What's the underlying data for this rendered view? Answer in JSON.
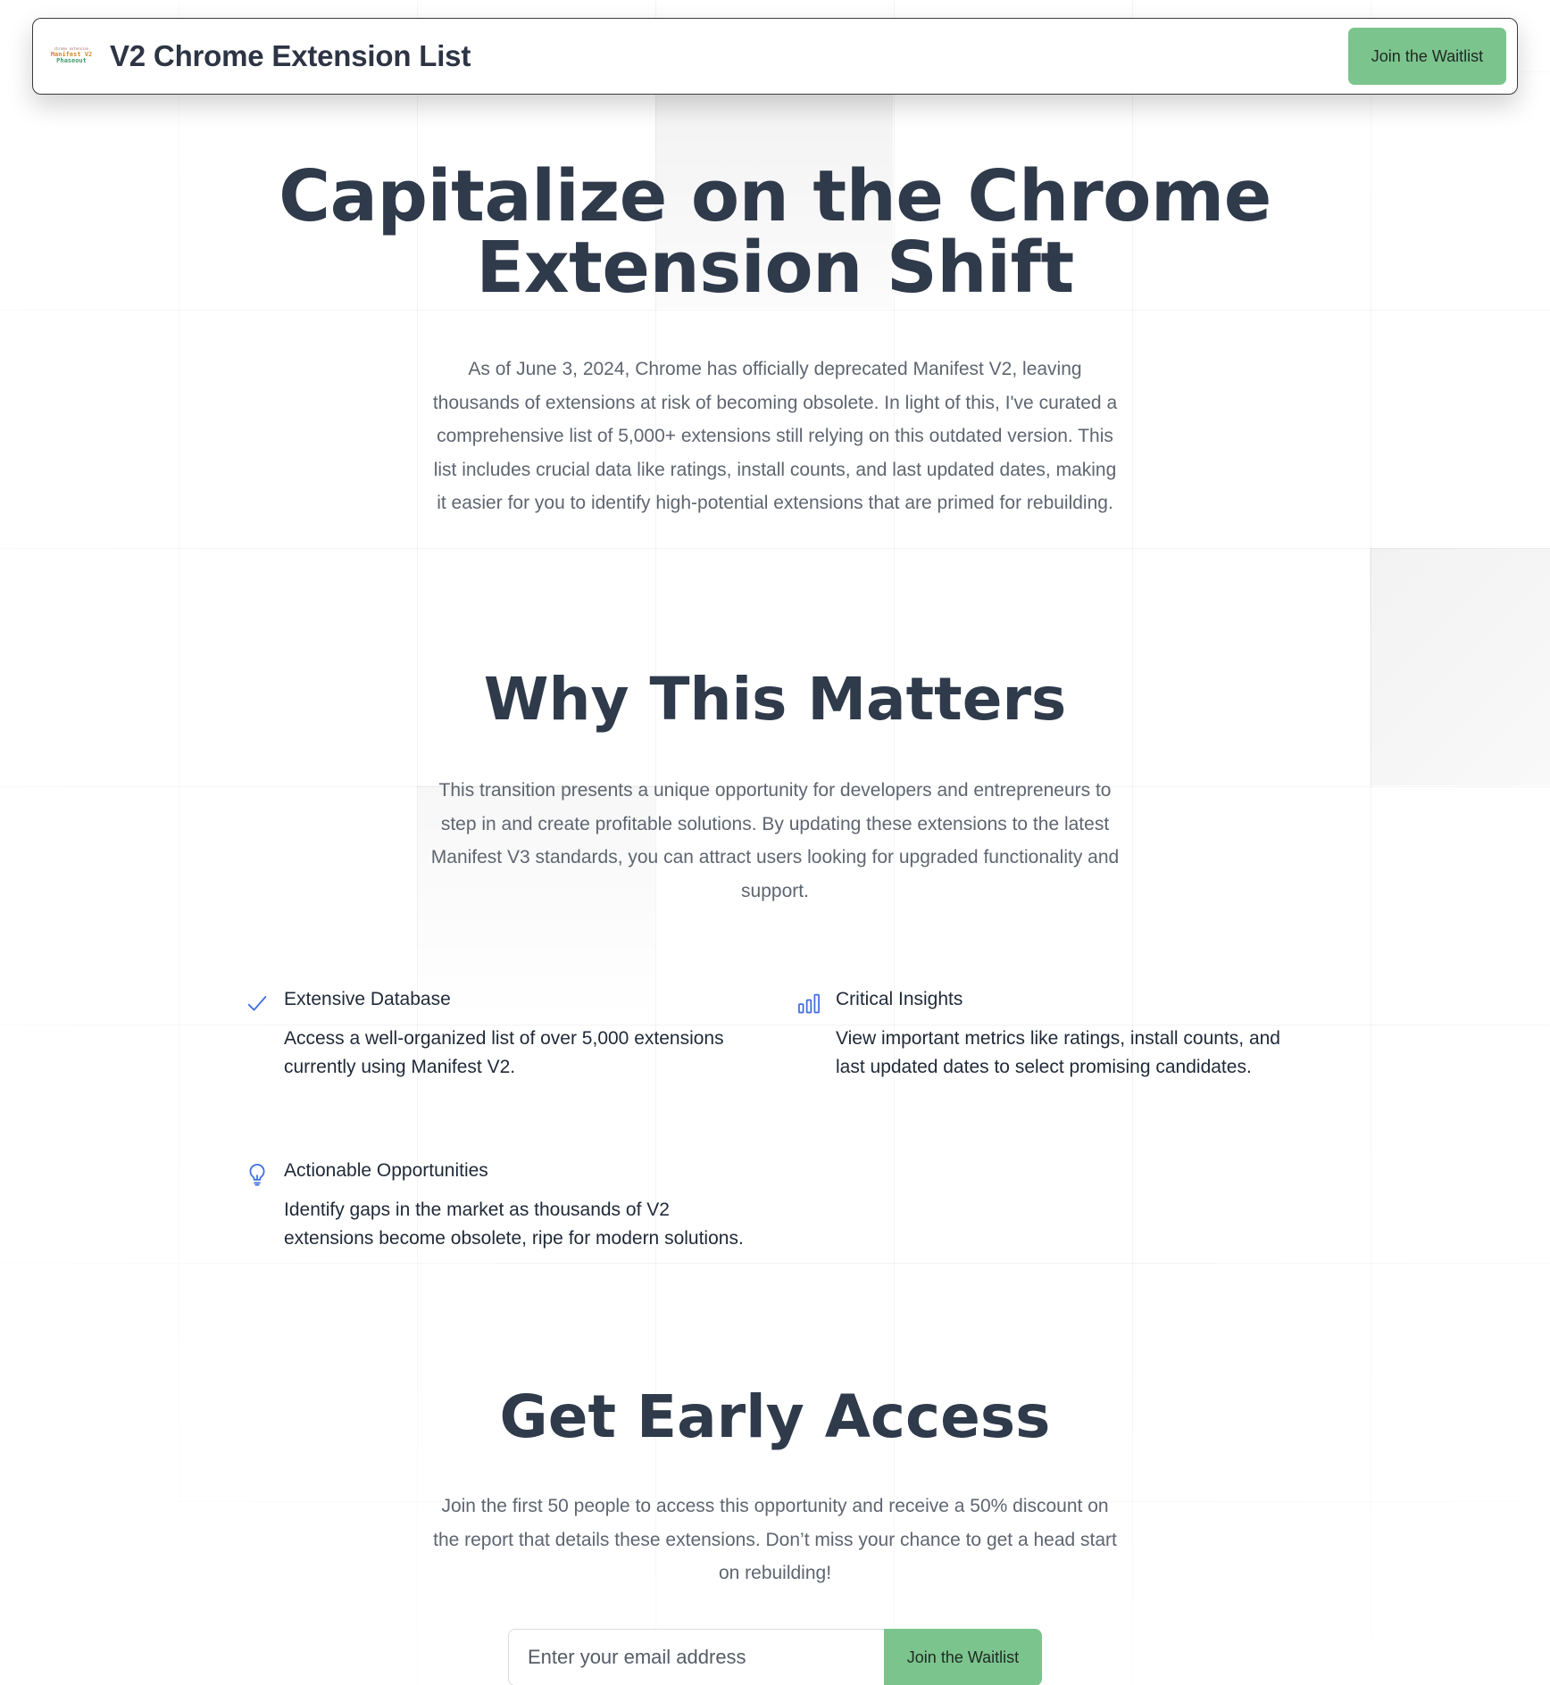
{
  "header": {
    "logo": {
      "top_text": "chrome extension",
      "line1": "Manifest V2",
      "line2": "Phaseout"
    },
    "title": "V2 Chrome Extension List",
    "cta_label": "Join the Waitlist"
  },
  "hero": {
    "title_line1": "Capitalize on the Chrome",
    "title_line2": "Extension Shift",
    "paragraph": "As of June 3, 2024, Chrome has officially deprecated Manifest V2, leaving thousands of extensions at risk of becoming obsolete. In light of this, I've curated a comprehensive list of 5,000+ extensions still relying on this outdated version. This list includes crucial data like ratings, install counts, and last updated dates, making it easier for you to identify high-potential extensions that are primed for rebuilding."
  },
  "why": {
    "title": "Why This Matters",
    "paragraph": "This transition presents a unique opportunity for developers and entrepreneurs to step in and create profitable solutions. By updating these extensions to the latest Manifest V3 standards, you can attract users looking for upgraded functionality and support.",
    "features": [
      {
        "icon": "checkmark-icon",
        "title": "Extensive Database",
        "description": "Access a well-organized list of over 5,000 extensions currently using Manifest V2."
      },
      {
        "icon": "bar-chart-icon",
        "title": "Critical Insights",
        "description": "View important metrics like ratings, install counts, and last updated dates to select promising candidates."
      },
      {
        "icon": "lightbulb-icon",
        "title": "Actionable Opportunities",
        "description": "Identify gaps in the market as thousands of V2 extensions become obsolete, ripe for modern solutions."
      }
    ]
  },
  "early_access": {
    "title": "Get Early Access",
    "paragraph": "Join the first 50 people to access this opportunity and receive a 50% discount on the report that details these extensions. Don’t miss your chance to get a head start on rebuilding!",
    "email_placeholder": "Enter your email address",
    "email_value": "",
    "button_label": "Join the Waitlist"
  },
  "colors": {
    "accent_green": "#7cc48d",
    "icon_blue": "#3f6fe0",
    "heading": "#2f3a4b",
    "body_text": "#5f6570"
  }
}
